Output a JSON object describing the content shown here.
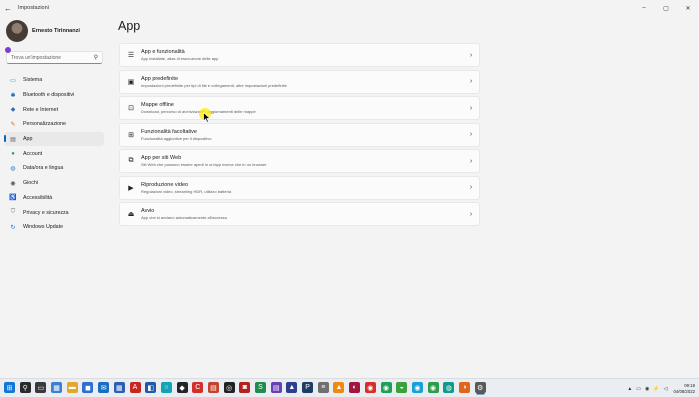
{
  "window": {
    "title": "Impostazioni",
    "controls": [
      "–",
      "▢",
      "✕"
    ]
  },
  "profile": {
    "name": "Ernesto Tirinnanzi"
  },
  "search": {
    "placeholder": "Trova un'impostazione"
  },
  "nav": [
    {
      "label": "Sistema",
      "icon": "monitor-icon",
      "glyph": "▭",
      "color": "#0a7ad9"
    },
    {
      "label": "Bluetooth e dispositivi",
      "icon": "bluetooth-icon",
      "glyph": "✱",
      "color": "#0a63c9"
    },
    {
      "label": "Rete e Internet",
      "icon": "wifi-icon",
      "glyph": "◆",
      "color": "#2e6fb7"
    },
    {
      "label": "Personalizzazione",
      "icon": "brush-icon",
      "glyph": "✎",
      "color": "#d66a17"
    },
    {
      "label": "App",
      "icon": "apps-icon",
      "glyph": "▤",
      "color": "#5a5a5a",
      "active": true
    },
    {
      "label": "Account",
      "icon": "account-icon",
      "glyph": "●",
      "color": "#2aa05a"
    },
    {
      "label": "Data/ora e lingua",
      "icon": "globe-clock-icon",
      "glyph": "◍",
      "color": "#1f7ad1"
    },
    {
      "label": "Giochi",
      "icon": "gamepad-icon",
      "glyph": "◉",
      "color": "#555555"
    },
    {
      "label": "Accessibilità",
      "icon": "accessibility-icon",
      "glyph": "♿",
      "color": "#1f6fc2"
    },
    {
      "label": "Privacy e sicurezza",
      "icon": "shield-icon",
      "glyph": "⛉",
      "color": "#6b6b6b"
    },
    {
      "label": "Windows Update",
      "icon": "windows-update-icon",
      "glyph": "↻",
      "color": "#0a78d4"
    }
  ],
  "main": {
    "title": "App",
    "cards": [
      {
        "title": "App e funzionalità",
        "subtitle": "App installate, alias di esecuzione delle app",
        "icon": "app-list-icon",
        "glyph": "☰"
      },
      {
        "title": "App predefinite",
        "subtitle": "Impostazioni predefinite per tipi di file e collegamenti, altre impostazioni predefinite",
        "icon": "default-apps-icon",
        "glyph": "▣"
      },
      {
        "title": "Mappe offline",
        "subtitle": "Download, percorso di archiviazione, aggiornamenti delle mappe",
        "icon": "offline-maps-icon",
        "glyph": "⊡"
      },
      {
        "title": "Funzionalità facoltative",
        "subtitle": "Funzionalità aggiuntive per il dispositivo",
        "icon": "optional-features-icon",
        "glyph": "⊞"
      },
      {
        "title": "App per siti Web",
        "subtitle": "Siti Web che possono essere aperti in un'app invece che in un browser",
        "icon": "app-websites-icon",
        "glyph": "⧉"
      },
      {
        "title": "Riproduzione video",
        "subtitle": "Regolazioni video, streaming HDR, utilizzo batteria",
        "icon": "video-playback-icon",
        "glyph": "▶"
      },
      {
        "title": "Avvio",
        "subtitle": "App che si avviano automaticamente all'accesso",
        "icon": "startup-icon",
        "glyph": "⏏"
      }
    ],
    "chevron": "›"
  },
  "taskbar": {
    "apps": [
      {
        "name": "windows-start-icon",
        "color": "#1477d4",
        "glyph": "⊞"
      },
      {
        "name": "search-icon",
        "color": "#2b2b2b",
        "glyph": "⚲"
      },
      {
        "name": "task-view-icon",
        "color": "#3a3a3a",
        "glyph": "▭"
      },
      {
        "name": "widgets-icon",
        "color": "#3f7fd0",
        "glyph": "▦"
      },
      {
        "name": "explorer-icon",
        "color": "#e2a82b",
        "glyph": "▬"
      },
      {
        "name": "store-icon",
        "color": "#2f6fd0",
        "glyph": "◼"
      },
      {
        "name": "mail-icon",
        "color": "#1a6ec2",
        "glyph": "✉"
      },
      {
        "name": "calendar-icon",
        "color": "#2a5fb4",
        "glyph": "▦"
      },
      {
        "name": "pdf-icon",
        "color": "#c7251f",
        "glyph": "A"
      },
      {
        "name": "app-blue-icon",
        "color": "#1e5aa8",
        "glyph": "◧"
      },
      {
        "name": "app-teal-icon",
        "color": "#12a3b6",
        "glyph": "○"
      },
      {
        "name": "app-dark-icon",
        "color": "#252525",
        "glyph": "◆"
      },
      {
        "name": "app-red-icon",
        "color": "#d4302b",
        "glyph": "C"
      },
      {
        "name": "app-red-orange-icon",
        "color": "#c4432b",
        "glyph": "▤"
      },
      {
        "name": "app-black-icon",
        "color": "#222222",
        "glyph": "◎"
      },
      {
        "name": "app-darkred-icon",
        "color": "#b1221f",
        "glyph": "◙"
      },
      {
        "name": "app-green-icon",
        "color": "#1f8b4c",
        "glyph": "S"
      },
      {
        "name": "app-purple-icon",
        "color": "#6a3fb4",
        "glyph": "▤"
      },
      {
        "name": "app-navy-icon",
        "color": "#2d3f8c",
        "glyph": "▲"
      },
      {
        "name": "app-photoshop-icon",
        "color": "#1c3d66",
        "glyph": "P"
      },
      {
        "name": "app-gray-icon",
        "color": "#707070",
        "glyph": "≡"
      },
      {
        "name": "vlc-icon",
        "color": "#ef8a10",
        "glyph": "▲"
      },
      {
        "name": "app-crimson-icon",
        "color": "#a0163f",
        "glyph": "◐"
      },
      {
        "name": "app-red2-icon",
        "color": "#d4302b",
        "glyph": "◉"
      },
      {
        "name": "app-green2-icon",
        "color": "#1e9e57",
        "glyph": "◉"
      },
      {
        "name": "app-lime-icon",
        "color": "#3aa13c",
        "glyph": "◒"
      },
      {
        "name": "app-cyan-icon",
        "color": "#1aa0d8",
        "glyph": "◉"
      },
      {
        "name": "chrome-icon",
        "color": "#2d9c4b",
        "glyph": "◉"
      },
      {
        "name": "app-teal2-icon",
        "color": "#0f9a8a",
        "glyph": "◍"
      },
      {
        "name": "app-orange-icon",
        "color": "#e0651d",
        "glyph": "◑"
      },
      {
        "name": "settings-gear-icon",
        "color": "#5a5a5a",
        "glyph": "⚙",
        "active": true
      }
    ],
    "tray_icons": [
      "▲",
      "▭",
      "◉",
      "⚡",
      "◁"
    ],
    "time": "09:19",
    "date": "04/08/2022"
  }
}
